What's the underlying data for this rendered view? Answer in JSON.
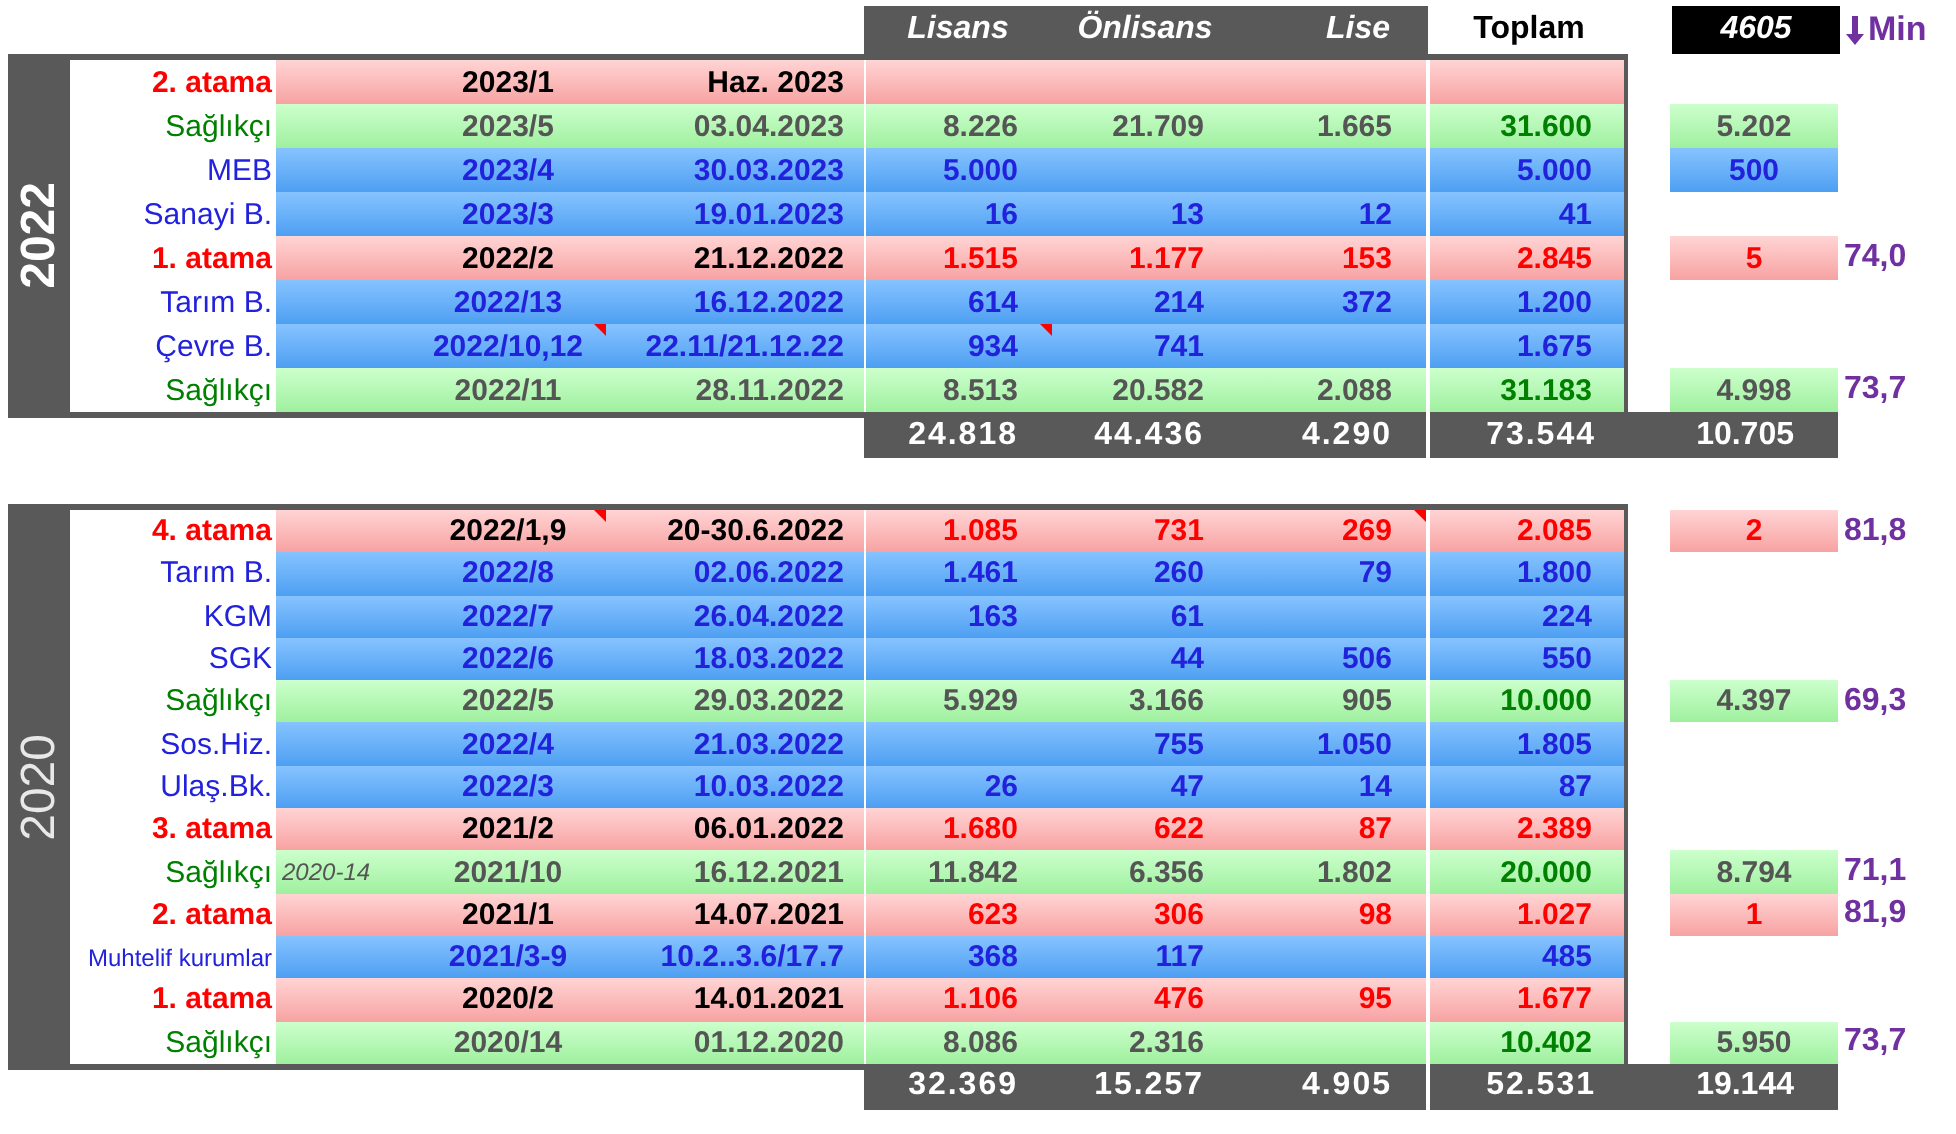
{
  "header": {
    "columns": [
      "Lisans",
      "Önlisans",
      "Lise"
    ],
    "total": "Toplam",
    "min_value": "4605",
    "min_label": "Min"
  },
  "sections": [
    {
      "year": "2022",
      "bold": true,
      "rows": [
        {
          "kind": "atama",
          "name": "2. atama",
          "no": "2023/1",
          "date": "Haz. 2023"
        },
        {
          "kind": "saglik",
          "name": "Sağlıkçı",
          "no": "2023/5",
          "date": "03.04.2023",
          "lisans": "8.226",
          "onlisans": "21.709",
          "lise": "1.665",
          "toplam": "31.600",
          "min": "5.202"
        },
        {
          "kind": "kurum",
          "name": "MEB",
          "no": "2023/4",
          "date": "30.03.2023",
          "lisans": "5.000",
          "toplam": "5.000",
          "min": "500"
        },
        {
          "kind": "kurum",
          "name": "Sanayi B.",
          "no": "2023/3",
          "date": "19.01.2023",
          "lisans": "16",
          "onlisans": "13",
          "lise": "12",
          "toplam": "41"
        },
        {
          "kind": "atama",
          "name": "1. atama",
          "no": "2022/2",
          "date": "21.12.2022",
          "lisans": "1.515",
          "onlisans": "1.177",
          "lise": "153",
          "toplam": "2.845",
          "min": "5",
          "score": "74,0"
        },
        {
          "kind": "kurum",
          "name": "Tarım B.",
          "no": "2022/13",
          "date": "16.12.2022",
          "lisans": "614",
          "onlisans": "214",
          "lise": "372",
          "toplam": "1.200"
        },
        {
          "kind": "kurum",
          "name": "Çevre B.",
          "no": "2022/10,12",
          "date": "22.11/21.12.22",
          "lisans": "934",
          "onlisans": "741",
          "toplam": "1.675",
          "comment_flags": {
            "no": true,
            "lisans": true
          }
        },
        {
          "kind": "saglik",
          "name": "Sağlıkçı",
          "no": "2022/11",
          "date": "28.11.2022",
          "lisans": "8.513",
          "onlisans": "20.582",
          "lise": "2.088",
          "toplam": "31.183",
          "min": "4.998",
          "score": "73,7"
        }
      ],
      "totals": {
        "lisans": "24.818",
        "onlisans": "44.436",
        "lise": "4.290",
        "toplam": "73.544",
        "min": "10.705"
      }
    },
    {
      "year": "2020",
      "bold": false,
      "rows": [
        {
          "kind": "atama",
          "name": "4. atama",
          "no": "2022/1,9",
          "date": "20-30.6.2022",
          "lisans": "1.085",
          "onlisans": "731",
          "lise": "269",
          "toplam": "2.085",
          "min": "2",
          "score": "81,8",
          "comment_flags": {
            "no": true,
            "lise": true
          }
        },
        {
          "kind": "kurum",
          "name": "Tarım B.",
          "no": "2022/8",
          "date": "02.06.2022",
          "lisans": "1.461",
          "onlisans": "260",
          "lise": "79",
          "toplam": "1.800"
        },
        {
          "kind": "kurum",
          "name": "KGM",
          "no": "2022/7",
          "date": "26.04.2022",
          "lisans": "163",
          "onlisans": "61",
          "toplam": "224"
        },
        {
          "kind": "kurum",
          "name": "SGK",
          "no": "2022/6",
          "date": "18.03.2022",
          "onlisans": "44",
          "lise": "506",
          "toplam": "550"
        },
        {
          "kind": "saglik",
          "name": "Sağlıkçı",
          "no": "2022/5",
          "date": "29.03.2022",
          "lisans": "5.929",
          "onlisans": "3.166",
          "lise": "905",
          "toplam": "10.000",
          "min": "4.397",
          "score": "69,3"
        },
        {
          "kind": "kurum",
          "name": "Sos.Hiz.",
          "no": "2022/4",
          "date": "21.03.2022",
          "onlisans": "755",
          "lise": "1.050",
          "toplam": "1.805"
        },
        {
          "kind": "kurum",
          "name": "Ulaş.Bk.",
          "no": "2022/3",
          "date": "10.03.2022",
          "lisans": "26",
          "onlisans": "47",
          "lise": "14",
          "toplam": "87"
        },
        {
          "kind": "atama",
          "name": "3. atama",
          "no": "2021/2",
          "date": "06.01.2022",
          "lisans": "1.680",
          "onlisans": "622",
          "lise": "87",
          "toplam": "2.389"
        },
        {
          "kind": "saglik",
          "name": "Sağlıkçı",
          "note": "2020-14",
          "no": "2021/10",
          "date": "16.12.2021",
          "lisans": "11.842",
          "onlisans": "6.356",
          "lise": "1.802",
          "toplam": "20.000",
          "min": "8.794",
          "score": "71,1"
        },
        {
          "kind": "atama",
          "name": "2. atama",
          "no": "2021/1",
          "date": "14.07.2021",
          "lisans": "623",
          "onlisans": "306",
          "lise": "98",
          "toplam": "1.027",
          "min": "1",
          "score": "81,9"
        },
        {
          "kind": "kurum",
          "name": "Muhtelif kurumlar",
          "no": "2021/3-9",
          "date": "10.2..3.6/17.7",
          "lisans": "368",
          "onlisans": "117",
          "toplam": "485"
        },
        {
          "kind": "atama",
          "name": "1. atama",
          "no": "2020/2",
          "date": "14.01.2021",
          "lisans": "1.106",
          "onlisans": "476",
          "lise": "95",
          "toplam": "1.677"
        },
        {
          "kind": "saglik",
          "name": "Sağlıkçı",
          "no": "2020/14",
          "date": "01.12.2020",
          "lisans": "8.086",
          "onlisans": "2.316",
          "toplam": "10.402",
          "min": "5.950",
          "score": "73,7"
        }
      ],
      "totals": {
        "lisans": "32.369",
        "onlisans": "15.257",
        "lise": "4.905",
        "toplam": "52.531",
        "min": "19.144"
      }
    }
  ]
}
